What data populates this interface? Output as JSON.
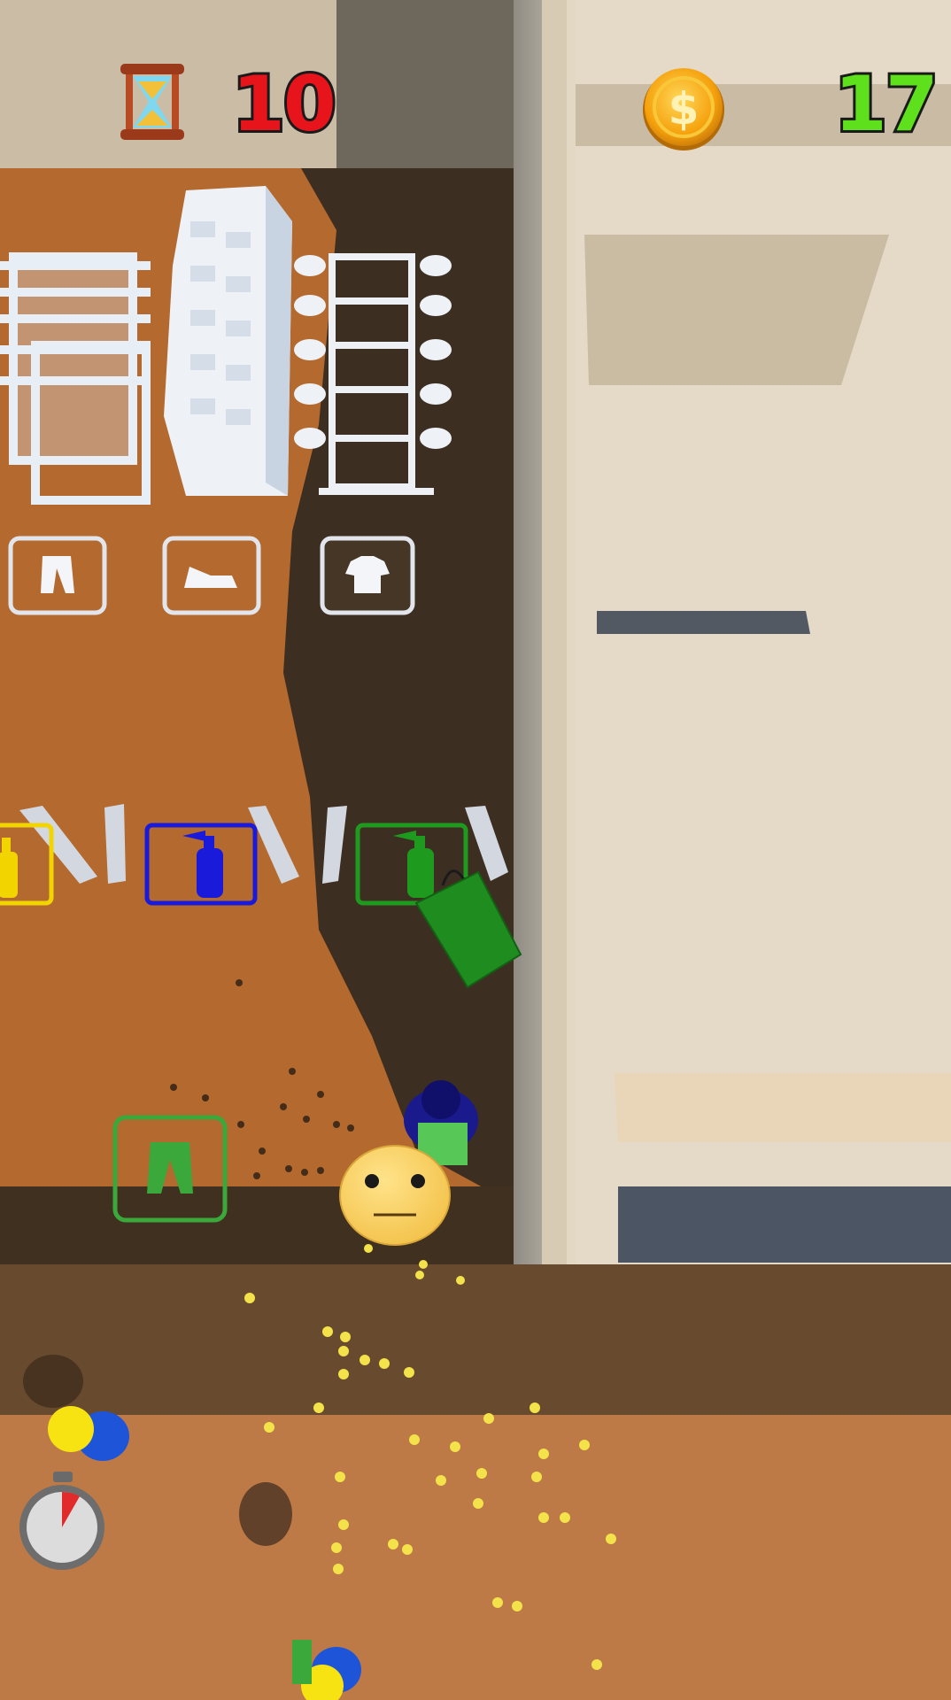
{
  "hud": {
    "timer": {
      "icon": "hourglass-icon",
      "value": "10",
      "color": "#e8141c"
    },
    "coins": {
      "icon": "dollar-coin-icon",
      "value": "17",
      "color": "#5fe01c"
    }
  },
  "shelf_pads": [
    {
      "icon": "pants-icon"
    },
    {
      "icon": "shoe-icon"
    },
    {
      "icon": "tshirt-icon"
    }
  ],
  "paint_stations": [
    {
      "icon": "spray-can-icon",
      "color": "#f2d400"
    },
    {
      "icon": "spray-can-icon",
      "color": "#1a1adb"
    },
    {
      "icon": "spray-can-icon",
      "color": "#1e9b1e"
    }
  ],
  "drop_zone": {
    "icon": "green-pants-icon",
    "color": "#3aa83a"
  },
  "shopping_bag": {
    "color": "#1e8c1e"
  },
  "customer_mood": {
    "icon": "neutral-face-icon"
  },
  "stopwatch": {
    "icon": "stopwatch-icon"
  }
}
